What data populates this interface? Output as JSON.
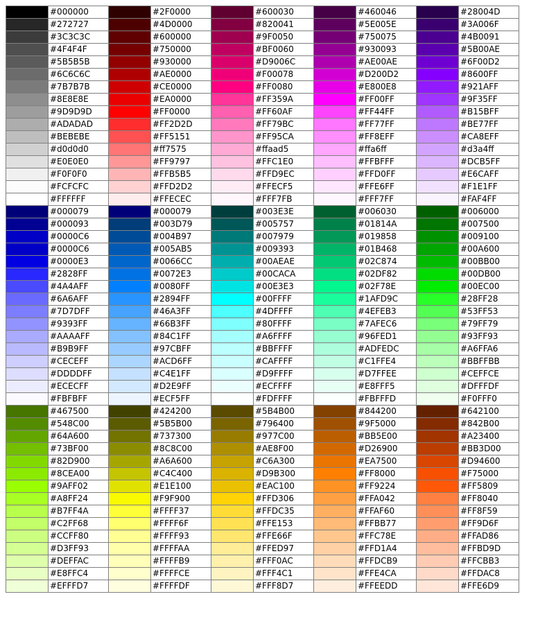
{
  "palette_table": {
    "rows": [
      [
        "#000000",
        "#2F0000",
        "#600030",
        "#460046",
        "#28004D"
      ],
      [
        "#272727",
        "#4D0000",
        "#820041",
        "#5E005E",
        "#3A006F"
      ],
      [
        "#3C3C3C",
        "#600000",
        "#9F0050",
        "#750075",
        "#4B0091"
      ],
      [
        "#4F4F4F",
        "#750000",
        "#BF0060",
        "#930093",
        "#5B00AE"
      ],
      [
        "#5B5B5B",
        "#930000",
        "#D9006C",
        "#AE00AE",
        "#6F00D2"
      ],
      [
        "#6C6C6C",
        "#AE0000",
        "#F00078",
        "#D200D2",
        "#8600FF"
      ],
      [
        "#7B7B7B",
        "#CE0000",
        "#FF0080",
        "#E800E8",
        "#921AFF"
      ],
      [
        "#8E8E8E",
        "#EA0000",
        "#FF359A",
        "#FF00FF",
        "#9F35FF"
      ],
      [
        "#9D9D9D",
        "#FF0000",
        "#FF60AF",
        "#FF44FF",
        "#B15BFF"
      ],
      [
        "#ADADAD",
        "#FF2D2D",
        "#FF79BC",
        "#FF77FF",
        "#BE77FF"
      ],
      [
        "#BEBEBE",
        "#FF5151",
        "#FF95CA",
        "#FF8EFF",
        "#CA8EFF"
      ],
      [
        "#d0d0d0",
        "#ff7575",
        "#ffaad5",
        "#ffa6ff",
        "#d3a4ff"
      ],
      [
        "#E0E0E0",
        "#FF9797",
        "#FFC1E0",
        "#FFBFFF",
        "#DCB5FF"
      ],
      [
        "#F0F0F0",
        "#FFB5B5",
        "#FFD9EC",
        "#FFD0FF",
        "#E6CAFF"
      ],
      [
        "#FCFCFC",
        "#FFD2D2",
        "#FFECF5",
        "#FFE6FF",
        "#F1E1FF"
      ],
      [
        "#FFFFFF",
        "#FFECEC",
        "#FFF7FB",
        "#FFF7FF",
        "#FAF4FF"
      ],
      [
        "#000079",
        "#000079",
        "#003E3E",
        "#006030",
        "#006000"
      ],
      [
        "#000093",
        "#003D79",
        "#005757",
        "#01814A",
        "#007500"
      ],
      [
        "#0000C6",
        "#004B97",
        "#007979",
        "#019858",
        "#009100"
      ],
      [
        "#0000C6",
        "#005AB5",
        "#009393",
        "#01B468",
        "#00A600"
      ],
      [
        "#0000E3",
        "#0066CC",
        "#00AEAE",
        "#02C874",
        "#00BB00"
      ],
      [
        "#2828FF",
        "#0072E3",
        "#00CACA",
        "#02DF82",
        "#00DB00"
      ],
      [
        "#4A4AFF",
        "#0080FF",
        "#00E3E3",
        "#02F78E",
        "#00EC00"
      ],
      [
        "#6A6AFF",
        "#2894FF",
        "#00FFFF",
        "#1AFD9C",
        "#28FF28"
      ],
      [
        "#7D7DFF",
        "#46A3FF",
        "#4DFFFF",
        "#4EFEB3",
        "#53FF53"
      ],
      [
        "#9393FF",
        "#66B3FF",
        "#80FFFF",
        "#7AFEC6",
        "#79FF79"
      ],
      [
        "#AAAAFF",
        "#84C1FF",
        "#A6FFFF",
        "#96FED1",
        "#93FF93"
      ],
      [
        "#B9B9FF",
        "#97CBFF",
        "#BBFFFF",
        "#ADFEDC",
        "#A6FFA6"
      ],
      [
        "#CECEFF",
        "#ACD6FF",
        "#CAFFFF",
        "#C1FFE4",
        "#BBFFBB"
      ],
      [
        "#DDDDFF",
        "#C4E1FF",
        "#D9FFFF",
        "#D7FFEE",
        "#CEFFCE"
      ],
      [
        "#ECECFF",
        "#D2E9FF",
        "#ECFFFF",
        "#E8FFF5",
        "#DFFFDF"
      ],
      [
        "#FBFBFF",
        "#ECF5FF",
        "#FDFFFF",
        "#FBFFFD",
        "#F0FFF0"
      ],
      [
        "#467500",
        "#424200",
        "#5B4B00",
        "#844200",
        "#642100"
      ],
      [
        "#548C00",
        "#5B5B00",
        "#796400",
        "#9F5000",
        "#842B00"
      ],
      [
        "#64A600",
        "#737300",
        "#977C00",
        "#BB5E00",
        "#A23400"
      ],
      [
        "#73BF00",
        "#8C8C00",
        "#AE8F00",
        "#D26900",
        "#BB3D00"
      ],
      [
        "#82D900",
        "#A6A600",
        "#C6A300",
        "#EA7500",
        "#D94600"
      ],
      [
        "#8CEA00",
        "#C4C400",
        "#D9B300",
        "#FF8000",
        "#F75000"
      ],
      [
        "#9AFF02",
        "#E1E100",
        "#EAC100",
        "#FF9224",
        "#FF5809"
      ],
      [
        "#A8FF24",
        "#F9F900",
        "#FFD306",
        "#FFA042",
        "#FF8040"
      ],
      [
        "#B7FF4A",
        "#FFFF37",
        "#FFDC35",
        "#FFAF60",
        "#FF8F59"
      ],
      [
        "#C2FF68",
        "#FFFF6F",
        "#FFE153",
        "#FFBB77",
        "#FF9D6F"
      ],
      [
        "#CCFF80",
        "#FFFF93",
        "#FFE66F",
        "#FFC78E",
        "#FFAD86"
      ],
      [
        "#D3FF93",
        "#FFFFAA",
        "#FFED97",
        "#FFD1A4",
        "#FFBD9D"
      ],
      [
        "#DEFFAC",
        "#FFFFB9",
        "#FFF0AC",
        "#FFDCB9",
        "#FFCBB3"
      ],
      [
        "#E8FFC4",
        "#FFFFCE",
        "#FFF4C1",
        "#FFE4CA",
        "#FFDAC8"
      ],
      [
        "#EFFFD7",
        "#FFFFDF",
        "#FFF8D7",
        "#FFEEDD",
        "#FFE6D9"
      ]
    ]
  }
}
